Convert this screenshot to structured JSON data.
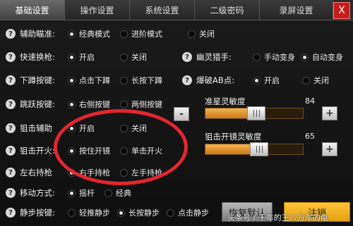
{
  "tabs": [
    {
      "label": "基础设置",
      "active": true
    },
    {
      "label": "操作设置",
      "active": false
    },
    {
      "label": "系统设置",
      "active": false
    },
    {
      "label": "二级密码",
      "active": false
    },
    {
      "label": "录屏设置",
      "active": false
    }
  ],
  "close_label": "X",
  "help_glyph": "?",
  "rows": {
    "aim_assist": {
      "label": "辅助瞄准:",
      "opts": [
        "经典模式",
        "进阶模式",
        "关闭"
      ],
      "selected": 0
    },
    "quick_switch": {
      "label": "快速换枪:",
      "opts": [
        "开启",
        "关闭"
      ],
      "selected": 0
    },
    "ghost_hunter": {
      "label": "幽灵猎手:",
      "opts": [
        "手动变身",
        "自动变身"
      ],
      "selected": 1
    },
    "crouch": {
      "label": "下蹲按键:",
      "opts": [
        "点击下蹲",
        "长按下蹲"
      ],
      "selected": 0
    },
    "explode_ab": {
      "label": "爆破AB点:",
      "opts": [
        "开启",
        "关闭"
      ],
      "selected": 0
    },
    "jump": {
      "label": "跳跃按键:",
      "opts": [
        "右侧按键",
        "两侧按键"
      ],
      "selected": 0
    },
    "sniper_assist": {
      "label": "狙击辅助",
      "opts": [
        "开启",
        "关闭"
      ],
      "selected": 0
    },
    "sniper_scope": {
      "label": "狙击开火:",
      "opts": [
        "按住开镜",
        "单击开火"
      ],
      "selected": 0
    },
    "left_right": {
      "label": "左右持枪",
      "opts": [
        "右手持枪",
        "左手持枪"
      ],
      "selected": 0
    },
    "move": {
      "label": "移动方式:",
      "opts": [
        "摇杆",
        "经典"
      ],
      "selected": 0
    },
    "still": {
      "label": "静步按键:",
      "opts": [
        "轻推静步",
        "长按静步",
        "点击静步"
      ],
      "selected": 1
    }
  },
  "sliders": {
    "crosshair": {
      "label": "准星灵敏度",
      "value": 84,
      "min": 0,
      "max": 100,
      "fill_percent": 0.55
    },
    "scope": {
      "label": "狙击开镜灵敏度",
      "value": 65,
      "min": 0,
      "max": 100,
      "fill_percent": 0.58
    }
  },
  "minus_label": "-",
  "plus_label": "+",
  "buttons": {
    "restore": "恢复默认",
    "logout": "注销"
  },
  "watermark": "头条号 / 千年的王八万年的龟",
  "colors": {
    "accent": "#f0a42a",
    "annotation": "#e3262f"
  }
}
